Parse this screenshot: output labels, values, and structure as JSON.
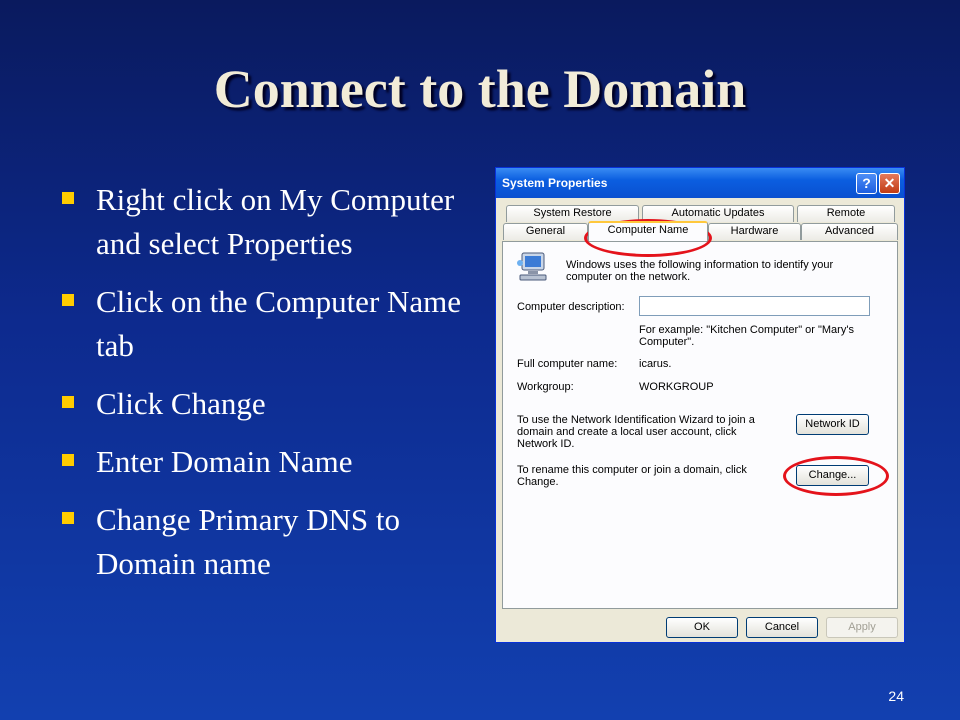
{
  "slide": {
    "title": "Connect to the Domain",
    "page_number": "24",
    "bullets": [
      "Right click on My Computer and select Properties",
      "Click on the Computer Name tab",
      "Click Change",
      "Enter Domain Name",
      "Change Primary DNS to Domain name"
    ]
  },
  "dialog": {
    "title": "System Properties",
    "help_label": "?",
    "close_label": "✕",
    "tabs_back": [
      "System Restore",
      "Automatic Updates",
      "Remote"
    ],
    "tabs_front": [
      "General",
      "Computer Name",
      "Hardware",
      "Advanced"
    ],
    "intro": "Windows uses the following information to identify your computer on the network.",
    "description_label": "Computer description:",
    "description_value": "",
    "example": "For example: \"Kitchen Computer\" or \"Mary's Computer\".",
    "full_name_label": "Full computer name:",
    "full_name_value": "icarus.",
    "workgroup_label": "Workgroup:",
    "workgroup_value": "WORKGROUP",
    "network_id_text": "To use the Network Identification Wizard to join a domain and create a local user account, click Network ID.",
    "network_id_button": "Network ID",
    "rename_text": "To rename this computer or join a domain, click Change.",
    "change_button": "Change...",
    "ok_button": "OK",
    "cancel_button": "Cancel",
    "apply_button": "Apply"
  },
  "colors": {
    "background": "#0d2a8e",
    "title": "#f2ecd8",
    "bullet_marker": "#ffcc00",
    "highlight": "#e4131b"
  },
  "icons": [
    "computer-network-icon",
    "help-icon",
    "close-icon"
  ]
}
